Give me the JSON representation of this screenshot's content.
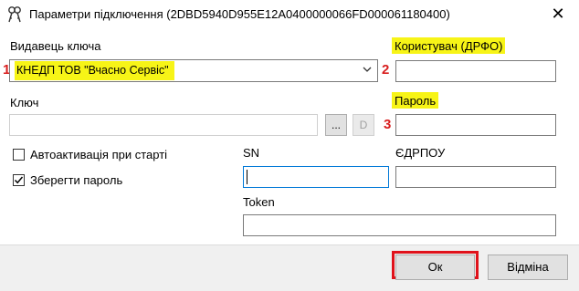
{
  "window": {
    "title": "Параметри підключення (2DBD5940D955E12A0400000066FD000061180400)",
    "icon": "keys-icon",
    "close_glyph": "✕"
  },
  "form": {
    "issuer_label": "Видавець ключа",
    "issuer_value": "КНЕДП ТОВ \"Вчасно Сервіс\"",
    "user_label": "Користувач (ДРФО)",
    "user_value": "",
    "key_label": "Ключ",
    "key_value": "",
    "browse_label": "...",
    "d_label": "D",
    "password_label": "Пароль",
    "password_value": "",
    "autoactivate_label": "Автоактивація при старті",
    "autoactivate_checked": false,
    "save_password_label": "Зберегти пароль",
    "save_password_checked": true,
    "sn_label": "SN",
    "sn_value": "",
    "edrpou_label": "ЄДРПОУ",
    "edrpou_value": "",
    "token_label": "Token",
    "token_value": ""
  },
  "markers": {
    "m1": "1",
    "m2": "2",
    "m3": "3"
  },
  "buttons": {
    "ok": "Ок",
    "cancel": "Відміна"
  },
  "colors": {
    "highlight": "#f7f417",
    "marker_red": "#d81e1e",
    "ok_frame": "#e0121b",
    "focus_blue": "#0078d7"
  }
}
